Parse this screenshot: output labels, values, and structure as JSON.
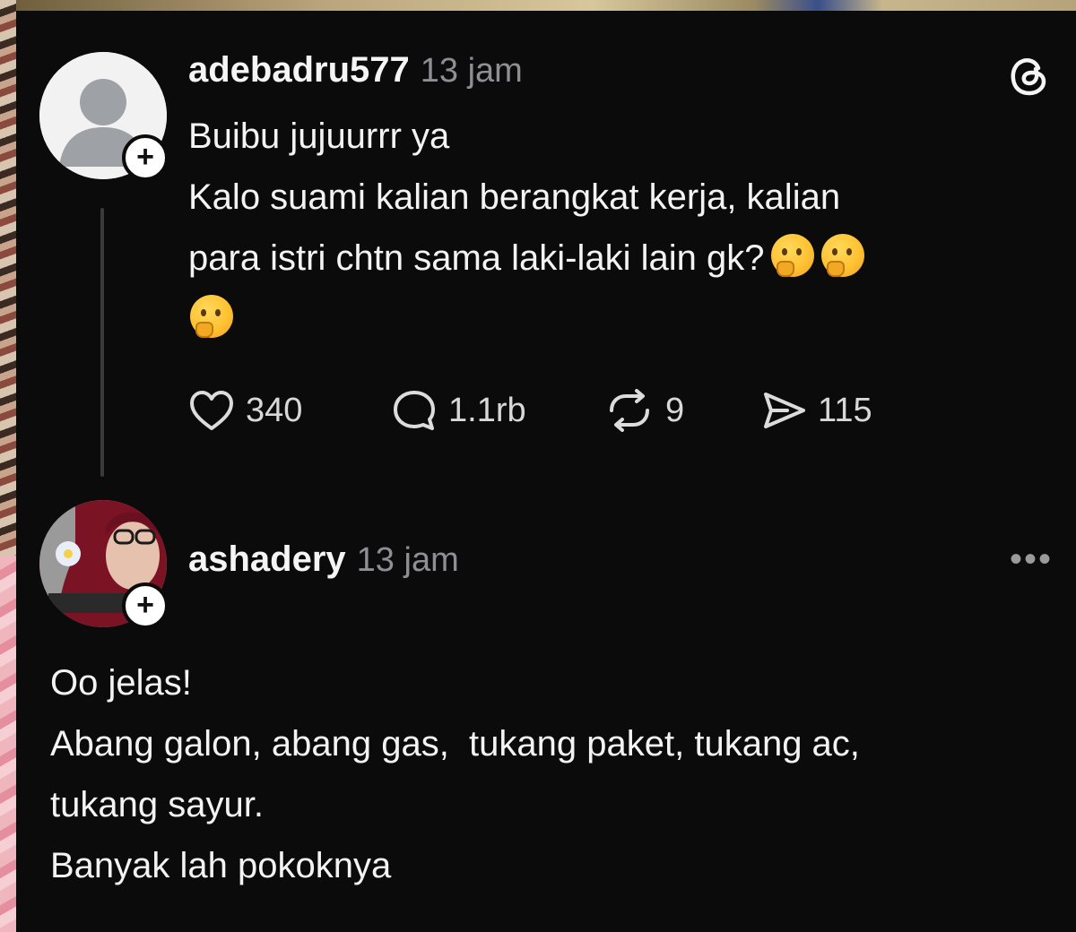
{
  "posts": [
    {
      "username": "adebadru577",
      "time": "13 jam",
      "lines": [
        "Buibu jujuurrr ya",
        "Kalo suami kalian berangkat kerja, kalian",
        "para istri chtn sama laki-laki lain gk?"
      ],
      "emoji_icon": "thinking-face-emoji",
      "actions": {
        "likes": "340",
        "comments": "1.1rb",
        "reposts": "9",
        "shares": "115"
      }
    },
    {
      "username": "ashadery",
      "time": "13 jam",
      "lines": [
        "Oo jelas!",
        "Abang galon, abang gas,  tukang paket, tukang ac,",
        "tukang sayur.",
        "Banyak lah pokoknya"
      ]
    }
  ],
  "icons": {
    "app_logo": "threads-logo-icon",
    "like": "heart-icon",
    "comment": "comment-bubble-icon",
    "repost": "repost-icon",
    "share": "send-icon",
    "more": "more-options-icon"
  },
  "colors": {
    "background": "#0b0b0c",
    "text": "#f3f3f3",
    "muted": "#8e8e93"
  }
}
